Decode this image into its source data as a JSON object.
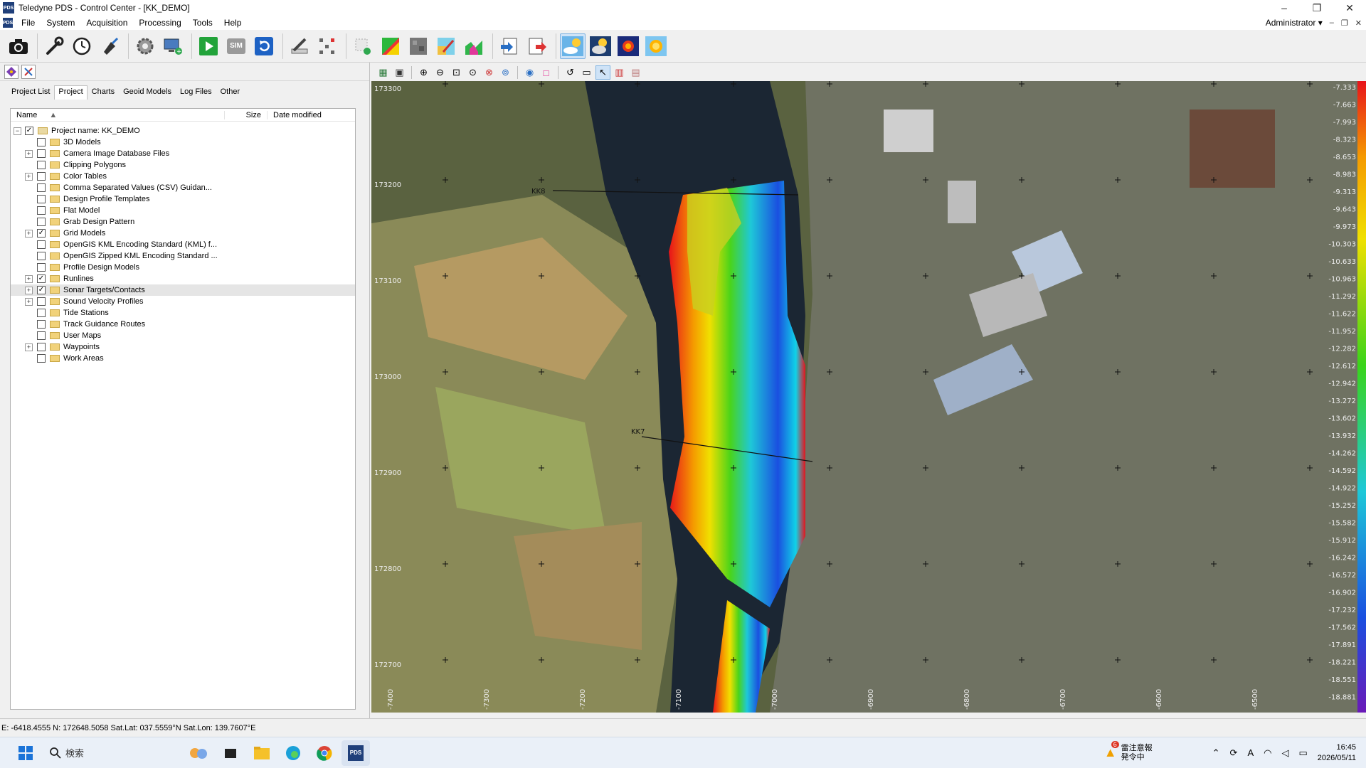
{
  "window": {
    "title": "Teledyne PDS - Control Center - [KK_DEMO]",
    "app_icon_text": "PDS",
    "minimize": "–",
    "restore": "❐",
    "close": "✕"
  },
  "menu": {
    "items": [
      "File",
      "System",
      "Acquisition",
      "Processing",
      "Tools",
      "Help"
    ],
    "user": "Administrator",
    "user_caret": "▾"
  },
  "toolbar": {
    "sim_label": "SIM"
  },
  "left_panel": {
    "tabs": [
      "Project List",
      "Project",
      "Charts",
      "Geoid Models",
      "Log Files",
      "Other"
    ],
    "active_tab": "Project",
    "columns": {
      "name": "Name",
      "size": "Size",
      "date": "Date modified"
    },
    "project_label": "Project name: KK_DEMO",
    "items": [
      {
        "label": "3D Models",
        "expandable": false,
        "checked": false
      },
      {
        "label": "Camera Image Database Files",
        "expandable": true,
        "checked": false
      },
      {
        "label": "Clipping Polygons",
        "expandable": false,
        "checked": false
      },
      {
        "label": "Color Tables",
        "expandable": true,
        "checked": false
      },
      {
        "label": "Comma Separated Values (CSV) Guidan...",
        "expandable": false,
        "checked": false
      },
      {
        "label": "Design Profile Templates",
        "expandable": false,
        "checked": false
      },
      {
        "label": "Flat Model",
        "expandable": false,
        "checked": false
      },
      {
        "label": "Grab Design Pattern",
        "expandable": false,
        "checked": false
      },
      {
        "label": "Grid Models",
        "expandable": true,
        "checked": true
      },
      {
        "label": "OpenGIS KML Encoding Standard (KML) f...",
        "expandable": false,
        "checked": false
      },
      {
        "label": "OpenGIS Zipped KML Encoding Standard ...",
        "expandable": false,
        "checked": false
      },
      {
        "label": "Profile Design Models",
        "expandable": false,
        "checked": false
      },
      {
        "label": "Runlines",
        "expandable": true,
        "checked": true
      },
      {
        "label": "Sonar Targets/Contacts",
        "expandable": true,
        "checked": true,
        "selected": true
      },
      {
        "label": "Sound Velocity Profiles",
        "expandable": true,
        "checked": false
      },
      {
        "label": "Tide Stations",
        "expandable": false,
        "checked": false
      },
      {
        "label": "Track Guidance Routes",
        "expandable": false,
        "checked": false
      },
      {
        "label": "User Maps",
        "expandable": false,
        "checked": false
      },
      {
        "label": "Waypoints",
        "expandable": true,
        "checked": false
      },
      {
        "label": "Work Areas",
        "expandable": false,
        "checked": false
      }
    ]
  },
  "map": {
    "northing_labels": [
      "173300",
      "173200",
      "173100",
      "173000",
      "172900",
      "172800",
      "172700"
    ],
    "easting_labels": [
      "-7400",
      "-7300",
      "-7200",
      "-7100",
      "-7000",
      "-6900",
      "-6800",
      "-6700",
      "-6600",
      "-6500"
    ],
    "depth_scale": [
      "-7.333",
      "-7.663",
      "-7.993",
      "-8.323",
      "-8.653",
      "-8.983",
      "-9.313",
      "-9.643",
      "-9.973",
      "-10.303",
      "-10.633",
      "-10.963",
      "-11.292",
      "-11.622",
      "-11.952",
      "-12.282",
      "-12.612",
      "-12.942",
      "-13.272",
      "-13.602",
      "-13.932",
      "-14.262",
      "-14.592",
      "-14.922",
      "-15.252",
      "-15.582",
      "-15.912",
      "-16.242",
      "-16.572",
      "-16.902",
      "-17.232",
      "-17.562",
      "-17.891",
      "-18.221",
      "-18.551",
      "-18.881"
    ],
    "runline_1": "KK8",
    "runline_2": "KK7",
    "colors": {
      "water": "#1b2633",
      "field": "#7c8a55",
      "town": "#6f7262"
    }
  },
  "status_bar": {
    "coords": "E: -6418.4555 N: 172648.5058 Sat.Lat: 037.5559°N Sat.Lon: 139.7607°E"
  },
  "taskbar": {
    "search_placeholder": "検索",
    "news_badge": "6",
    "news_title": "雷注意報",
    "news_sub": "発令中",
    "ime": "A",
    "time": "16:45",
    "date": "2026/05/11"
  }
}
